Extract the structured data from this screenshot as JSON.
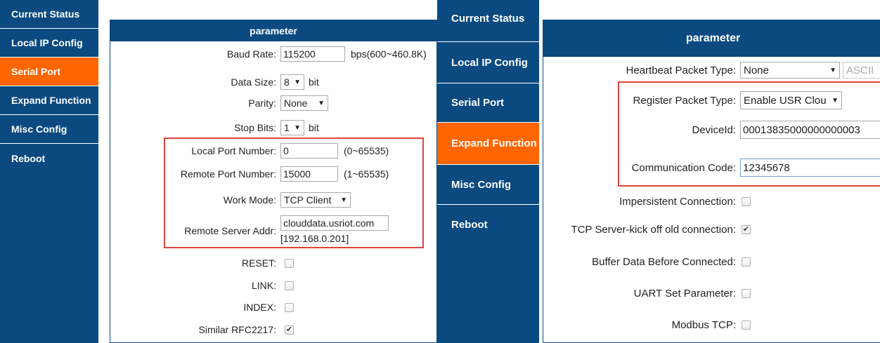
{
  "left": {
    "sidebar": [
      {
        "label": "Current Status"
      },
      {
        "label": "Local IP Config"
      },
      {
        "label": "Serial Port"
      },
      {
        "label": "Expand Function"
      },
      {
        "label": "Misc Config"
      },
      {
        "label": "Reboot"
      }
    ],
    "active_item": "Serial Port",
    "header": "parameter",
    "baud_rate": {
      "label": "Baud Rate:",
      "value": "115200",
      "unit": "bps(600~460.8K)"
    },
    "data_size": {
      "label": "Data Size:",
      "value": "8",
      "unit": "bit"
    },
    "parity": {
      "label": "Parity:",
      "value": "None"
    },
    "stop_bits": {
      "label": "Stop Bits:",
      "value": "1",
      "unit": "bit"
    },
    "local_port": {
      "label": "Local Port Number:",
      "value": "0",
      "range": "(0~65535)"
    },
    "remote_port": {
      "label": "Remote Port Number:",
      "value": "15000",
      "range": "(1~65535)"
    },
    "work_mode": {
      "label": "Work Mode:",
      "value": "TCP Client"
    },
    "remote_server": {
      "label": "Remote Server Addr:",
      "value": "clouddata.usriot.com",
      "resolved": "[192.168.0.201]"
    },
    "reset": {
      "label": "RESET:",
      "checked": false
    },
    "link": {
      "label": "LINK:",
      "checked": false
    },
    "index": {
      "label": "INDEX:",
      "checked": false
    },
    "rfc2217": {
      "label": "Similar RFC2217:",
      "checked": true
    }
  },
  "right": {
    "sidebar": [
      {
        "label": "Current Status"
      },
      {
        "label": "Local IP Config"
      },
      {
        "label": "Serial Port"
      },
      {
        "label": "Expand Function"
      },
      {
        "label": "Misc Config"
      },
      {
        "label": "Reboot"
      }
    ],
    "active_item": "Expand Function",
    "header": "parameter",
    "heartbeat_type": {
      "label": "Heartbeat Packet Type:",
      "value": "None",
      "format": "ASCII"
    },
    "register_type": {
      "label": "Register Packet Type:",
      "value": "Enable USR Clou"
    },
    "device_id": {
      "label": "DeviceId:",
      "value": "00013835000000000003"
    },
    "comm_code": {
      "label": "Communication Code:",
      "value": "12345678"
    },
    "impersistent": {
      "label": "Impersistent Connection:",
      "checked": false
    },
    "kick_off": {
      "label": "TCP Server-kick off old connection:",
      "checked": true
    },
    "buffer_data": {
      "label": "Buffer Data Before Connected:",
      "checked": false
    },
    "uart_param": {
      "label": "UART Set Parameter:",
      "checked": false
    },
    "modbus_tcp": {
      "label": "Modbus TCP:",
      "checked": false
    }
  },
  "colors": {
    "nav_bg": "#0b4a80",
    "active_bg": "#ff6600",
    "highlight_box": "#e0443e"
  },
  "icons": {
    "checked": "check-mark",
    "dropdown": "triangle-down"
  }
}
